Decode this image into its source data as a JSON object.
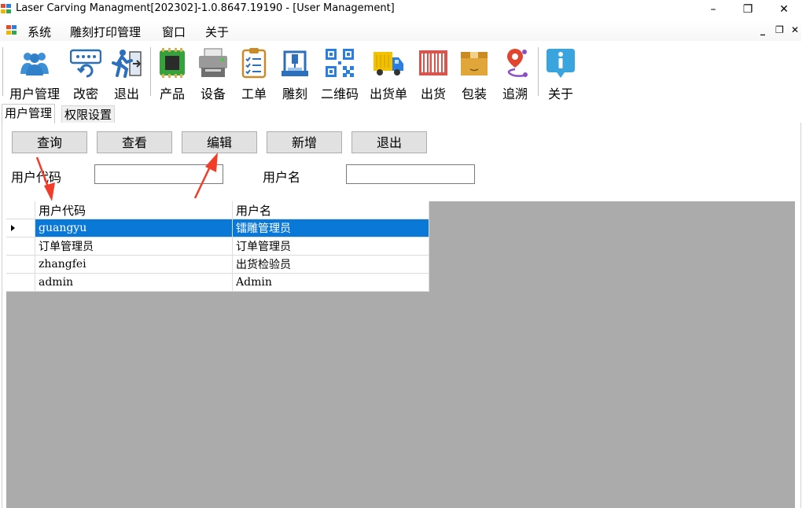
{
  "window": {
    "title": "Laser Carving Managment[202302]-1.0.8647.19190 - [User Management]",
    "min_glyph": "–",
    "restore_glyph": "❐",
    "close_glyph": "✕"
  },
  "menu": {
    "items": [
      "系统",
      "雕刻打印管理",
      "窗口",
      "关于"
    ],
    "mdi_min": "_",
    "mdi_restore": "❐",
    "mdi_close": "✕"
  },
  "toolbar": {
    "items": [
      {
        "label": "用户管理",
        "icon": "users-icon"
      },
      {
        "label": "改密",
        "icon": "password-refresh-icon"
      },
      {
        "label": "退出",
        "icon": "exit-run-icon"
      },
      {
        "label": "产品",
        "icon": "chip-icon"
      },
      {
        "label": "设备",
        "icon": "printer-icon"
      },
      {
        "label": "工单",
        "icon": "clipboard-checklist-icon"
      },
      {
        "label": "雕刻",
        "icon": "engraver-icon"
      },
      {
        "label": "二维码",
        "icon": "qr-code-icon"
      },
      {
        "label": "出货单",
        "icon": "truck-icon"
      },
      {
        "label": "出货",
        "icon": "barcode-icon"
      },
      {
        "label": "包装",
        "icon": "box-icon"
      },
      {
        "label": "追溯",
        "icon": "route-pin-icon"
      },
      {
        "label": "关于",
        "icon": "info-icon"
      }
    ]
  },
  "tabs": [
    "用户管理",
    "权限设置"
  ],
  "actions": {
    "query": "查询",
    "view": "查看",
    "edit": "编辑",
    "add": "新增",
    "exit": "退出"
  },
  "filters": {
    "user_code_label": "用户代码",
    "user_code_value": "",
    "user_name_label": "用户名",
    "user_name_value": ""
  },
  "grid": {
    "columns": [
      "用户代码",
      "用户名"
    ],
    "rows": [
      {
        "code": "guangyu",
        "name": "镭雕管理员"
      },
      {
        "code": "订单管理员",
        "name": "订单管理员"
      },
      {
        "code": "zhangfei",
        "name": "出货检验员"
      },
      {
        "code": "admin",
        "name": "Admin"
      }
    ],
    "selected_index": 0
  },
  "colors": {
    "selection": "#0a78d7",
    "grid_background": "#ababab",
    "button_face": "#e1e1e1",
    "annotation_arrow": "#f03c28"
  }
}
